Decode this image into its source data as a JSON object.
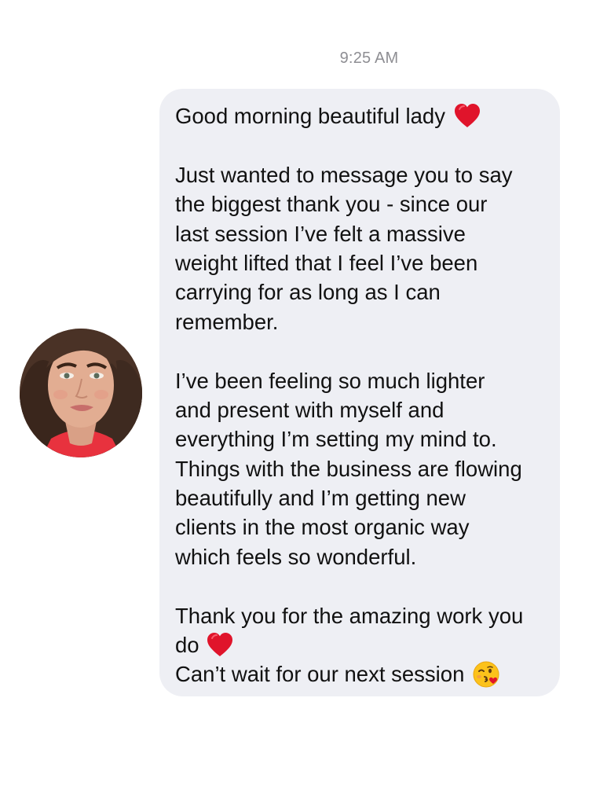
{
  "conversation": {
    "timestamp": "9:25 AM",
    "contact": {
      "avatar_icon": "profile-photo"
    },
    "message": {
      "lines": [
        {
          "text": "Good morning beautiful lady",
          "emoji": "red-heart-icon"
        },
        {
          "text": ""
        },
        {
          "text": "Just wanted to message you to say"
        },
        {
          "text": "the biggest thank you - since our"
        },
        {
          "text": "last session I’ve felt a massive"
        },
        {
          "text": "weight lifted that I feel I’ve been"
        },
        {
          "text": "carrying for as long as I can"
        },
        {
          "text": "remember."
        },
        {
          "text": ""
        },
        {
          "text": "I’ve been feeling so much lighter"
        },
        {
          "text": "and present with myself and"
        },
        {
          "text": "everything I’m setting my mind to."
        },
        {
          "text": "Things with the business are flowing"
        },
        {
          "text": "beautifully and I’m getting new"
        },
        {
          "text": "clients in the most organic way"
        },
        {
          "text": "which feels so wonderful."
        },
        {
          "text": ""
        },
        {
          "text": "Thank you for the amazing work you"
        },
        {
          "text": "do",
          "emoji": "red-heart-icon"
        },
        {
          "text": "Can’t wait for our next session",
          "emoji": "kissing-face-icon"
        }
      ]
    },
    "colors": {
      "bubble": "#eeeff4",
      "text": "#111111",
      "timestamp": "#8e8e93",
      "heart": "#e0142b"
    }
  }
}
